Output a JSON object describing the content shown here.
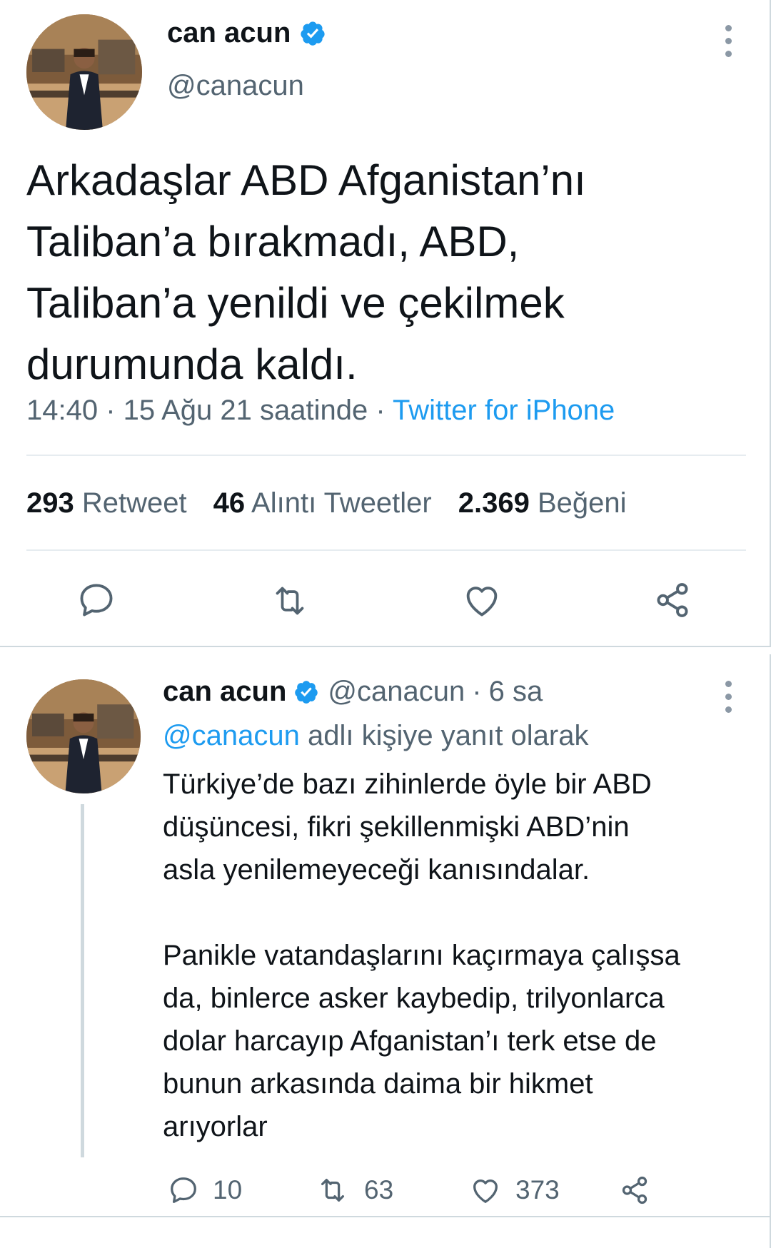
{
  "main_tweet": {
    "author_name": "can acun",
    "author_handle": "@canacun",
    "text_lines": [
      "Arkadaşlar ABD Afganistan’nı",
      "Taliban’a bırakmadı, ABD,",
      "Taliban’a yenildi ve çekilmek",
      "durumunda kaldı."
    ],
    "time": "14:40",
    "date": "15 Ağu 21 saatinde",
    "source": "Twitter for iPhone",
    "stats": {
      "retweets_count": "293",
      "retweets_label": "Retweet",
      "quotes_count": "46",
      "quotes_label": "Alıntı Tweetler",
      "likes_count": "2.369",
      "likes_label": "Beğeni"
    },
    "actions": [
      "reply-icon",
      "retweet-icon",
      "like-icon",
      "share-icon"
    ]
  },
  "reply_tweet": {
    "author_name": "can acun",
    "author_handle": "@canacun",
    "separator": "·",
    "time_ago": "6 sa",
    "replying_mention": "@canacun",
    "replying_suffix": "adlı kişiye yanıt olarak",
    "paragraph1_lines": [
      "Türkiye’de bazı zihinlerde öyle bir ABD",
      "düşüncesi, fikri şekillenmişki ABD’nin",
      "asla yenilemeyeceği kanısındalar."
    ],
    "paragraph2_lines": [
      "Panikle vatandaşlarını kaçırmaya çalışsa",
      "da, binlerce asker kaybedip, trilyonlarca",
      "dolar harcayıp Afganistan’ı terk etse de",
      "bunun arkasında daima bir hikmet",
      "arıyorlar"
    ],
    "reply_count": "10",
    "retweet_count": "63",
    "like_count": "373"
  },
  "colors": {
    "text": "#0f1419",
    "secondary": "#536471",
    "accent": "#1d9bf0",
    "divider": "#e6ecf0"
  }
}
